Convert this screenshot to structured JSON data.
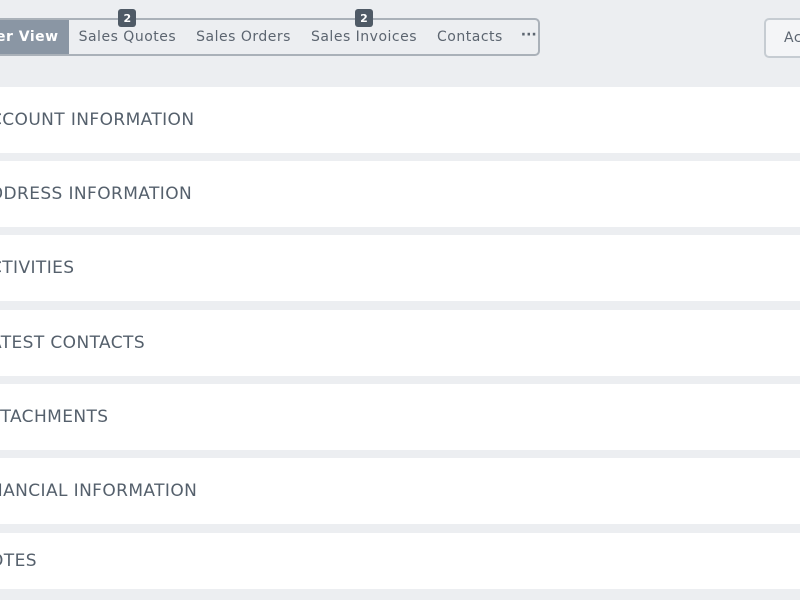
{
  "tabs": [
    {
      "label": "er View",
      "active": true,
      "badge": ""
    },
    {
      "label": "Sales Quotes",
      "active": false,
      "badge": "2"
    },
    {
      "label": "Sales Orders",
      "active": false,
      "badge": ""
    },
    {
      "label": "Sales Invoices",
      "active": false,
      "badge": "2"
    },
    {
      "label": "Contacts",
      "active": false,
      "badge": ""
    }
  ],
  "more_label": "···",
  "action_button_label": "Ac",
  "sections": [
    "CCOUNT INFORMATION",
    "DDRESS INFORMATION",
    "CTIVITIES",
    "ATEST CONTACTS",
    "TTACHMENTS",
    "NANCIAL INFORMATION",
    "OTES"
  ],
  "colors": {
    "background": "#eceef1",
    "active_tab": "#8a96a4",
    "badge": "#4f5a66",
    "panel": "#ffffff",
    "text": "#55606c"
  }
}
